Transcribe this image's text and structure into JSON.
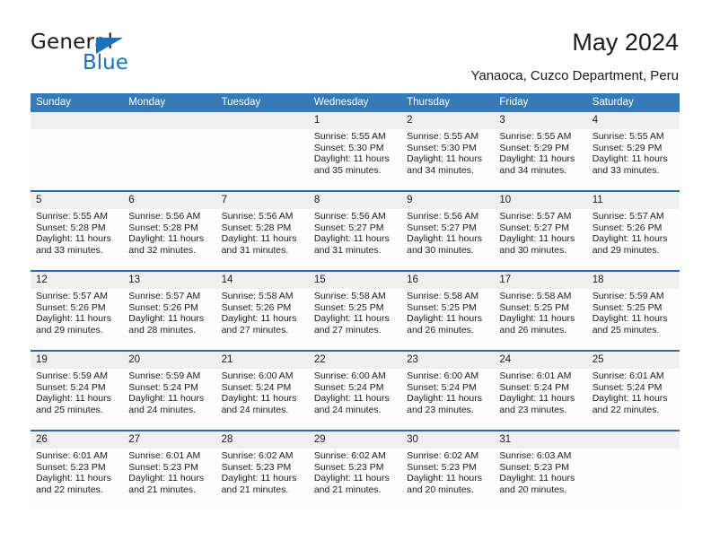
{
  "brand": {
    "name_top": "General",
    "name_bottom": "Blue",
    "accent_color": "#1a72b8"
  },
  "header": {
    "title": "May 2024",
    "subtitle": "Yanaoca, Cuzco Department, Peru"
  },
  "calendar": {
    "header_bg": "#3479b8",
    "datecell_bg": "#efefef",
    "weekday_headers": [
      "Sunday",
      "Monday",
      "Tuesday",
      "Wednesday",
      "Thursday",
      "Friday",
      "Saturday"
    ],
    "weeks": [
      [
        {
          "day": ""
        },
        {
          "day": ""
        },
        {
          "day": ""
        },
        {
          "day": "1",
          "sunrise": "Sunrise: 5:55 AM",
          "sunset": "Sunset: 5:30 PM",
          "daylight_1": "Daylight: 11 hours",
          "daylight_2": "and 35 minutes."
        },
        {
          "day": "2",
          "sunrise": "Sunrise: 5:55 AM",
          "sunset": "Sunset: 5:30 PM",
          "daylight_1": "Daylight: 11 hours",
          "daylight_2": "and 34 minutes."
        },
        {
          "day": "3",
          "sunrise": "Sunrise: 5:55 AM",
          "sunset": "Sunset: 5:29 PM",
          "daylight_1": "Daylight: 11 hours",
          "daylight_2": "and 34 minutes."
        },
        {
          "day": "4",
          "sunrise": "Sunrise: 5:55 AM",
          "sunset": "Sunset: 5:29 PM",
          "daylight_1": "Daylight: 11 hours",
          "daylight_2": "and 33 minutes."
        }
      ],
      [
        {
          "day": "5",
          "sunrise": "Sunrise: 5:55 AM",
          "sunset": "Sunset: 5:28 PM",
          "daylight_1": "Daylight: 11 hours",
          "daylight_2": "and 33 minutes."
        },
        {
          "day": "6",
          "sunrise": "Sunrise: 5:56 AM",
          "sunset": "Sunset: 5:28 PM",
          "daylight_1": "Daylight: 11 hours",
          "daylight_2": "and 32 minutes."
        },
        {
          "day": "7",
          "sunrise": "Sunrise: 5:56 AM",
          "sunset": "Sunset: 5:28 PM",
          "daylight_1": "Daylight: 11 hours",
          "daylight_2": "and 31 minutes."
        },
        {
          "day": "8",
          "sunrise": "Sunrise: 5:56 AM",
          "sunset": "Sunset: 5:27 PM",
          "daylight_1": "Daylight: 11 hours",
          "daylight_2": "and 31 minutes."
        },
        {
          "day": "9",
          "sunrise": "Sunrise: 5:56 AM",
          "sunset": "Sunset: 5:27 PM",
          "daylight_1": "Daylight: 11 hours",
          "daylight_2": "and 30 minutes."
        },
        {
          "day": "10",
          "sunrise": "Sunrise: 5:57 AM",
          "sunset": "Sunset: 5:27 PM",
          "daylight_1": "Daylight: 11 hours",
          "daylight_2": "and 30 minutes."
        },
        {
          "day": "11",
          "sunrise": "Sunrise: 5:57 AM",
          "sunset": "Sunset: 5:26 PM",
          "daylight_1": "Daylight: 11 hours",
          "daylight_2": "and 29 minutes."
        }
      ],
      [
        {
          "day": "12",
          "sunrise": "Sunrise: 5:57 AM",
          "sunset": "Sunset: 5:26 PM",
          "daylight_1": "Daylight: 11 hours",
          "daylight_2": "and 29 minutes."
        },
        {
          "day": "13",
          "sunrise": "Sunrise: 5:57 AM",
          "sunset": "Sunset: 5:26 PM",
          "daylight_1": "Daylight: 11 hours",
          "daylight_2": "and 28 minutes."
        },
        {
          "day": "14",
          "sunrise": "Sunrise: 5:58 AM",
          "sunset": "Sunset: 5:26 PM",
          "daylight_1": "Daylight: 11 hours",
          "daylight_2": "and 27 minutes."
        },
        {
          "day": "15",
          "sunrise": "Sunrise: 5:58 AM",
          "sunset": "Sunset: 5:25 PM",
          "daylight_1": "Daylight: 11 hours",
          "daylight_2": "and 27 minutes."
        },
        {
          "day": "16",
          "sunrise": "Sunrise: 5:58 AM",
          "sunset": "Sunset: 5:25 PM",
          "daylight_1": "Daylight: 11 hours",
          "daylight_2": "and 26 minutes."
        },
        {
          "day": "17",
          "sunrise": "Sunrise: 5:58 AM",
          "sunset": "Sunset: 5:25 PM",
          "daylight_1": "Daylight: 11 hours",
          "daylight_2": "and 26 minutes."
        },
        {
          "day": "18",
          "sunrise": "Sunrise: 5:59 AM",
          "sunset": "Sunset: 5:25 PM",
          "daylight_1": "Daylight: 11 hours",
          "daylight_2": "and 25 minutes."
        }
      ],
      [
        {
          "day": "19",
          "sunrise": "Sunrise: 5:59 AM",
          "sunset": "Sunset: 5:24 PM",
          "daylight_1": "Daylight: 11 hours",
          "daylight_2": "and 25 minutes."
        },
        {
          "day": "20",
          "sunrise": "Sunrise: 5:59 AM",
          "sunset": "Sunset: 5:24 PM",
          "daylight_1": "Daylight: 11 hours",
          "daylight_2": "and 24 minutes."
        },
        {
          "day": "21",
          "sunrise": "Sunrise: 6:00 AM",
          "sunset": "Sunset: 5:24 PM",
          "daylight_1": "Daylight: 11 hours",
          "daylight_2": "and 24 minutes."
        },
        {
          "day": "22",
          "sunrise": "Sunrise: 6:00 AM",
          "sunset": "Sunset: 5:24 PM",
          "daylight_1": "Daylight: 11 hours",
          "daylight_2": "and 24 minutes."
        },
        {
          "day": "23",
          "sunrise": "Sunrise: 6:00 AM",
          "sunset": "Sunset: 5:24 PM",
          "daylight_1": "Daylight: 11 hours",
          "daylight_2": "and 23 minutes."
        },
        {
          "day": "24",
          "sunrise": "Sunrise: 6:01 AM",
          "sunset": "Sunset: 5:24 PM",
          "daylight_1": "Daylight: 11 hours",
          "daylight_2": "and 23 minutes."
        },
        {
          "day": "25",
          "sunrise": "Sunrise: 6:01 AM",
          "sunset": "Sunset: 5:24 PM",
          "daylight_1": "Daylight: 11 hours",
          "daylight_2": "and 22 minutes."
        }
      ],
      [
        {
          "day": "26",
          "sunrise": "Sunrise: 6:01 AM",
          "sunset": "Sunset: 5:23 PM",
          "daylight_1": "Daylight: 11 hours",
          "daylight_2": "and 22 minutes."
        },
        {
          "day": "27",
          "sunrise": "Sunrise: 6:01 AM",
          "sunset": "Sunset: 5:23 PM",
          "daylight_1": "Daylight: 11 hours",
          "daylight_2": "and 21 minutes."
        },
        {
          "day": "28",
          "sunrise": "Sunrise: 6:02 AM",
          "sunset": "Sunset: 5:23 PM",
          "daylight_1": "Daylight: 11 hours",
          "daylight_2": "and 21 minutes."
        },
        {
          "day": "29",
          "sunrise": "Sunrise: 6:02 AM",
          "sunset": "Sunset: 5:23 PM",
          "daylight_1": "Daylight: 11 hours",
          "daylight_2": "and 21 minutes."
        },
        {
          "day": "30",
          "sunrise": "Sunrise: 6:02 AM",
          "sunset": "Sunset: 5:23 PM",
          "daylight_1": "Daylight: 11 hours",
          "daylight_2": "and 20 minutes."
        },
        {
          "day": "31",
          "sunrise": "Sunrise: 6:03 AM",
          "sunset": "Sunset: 5:23 PM",
          "daylight_1": "Daylight: 11 hours",
          "daylight_2": "and 20 minutes."
        },
        {
          "day": ""
        }
      ]
    ]
  }
}
